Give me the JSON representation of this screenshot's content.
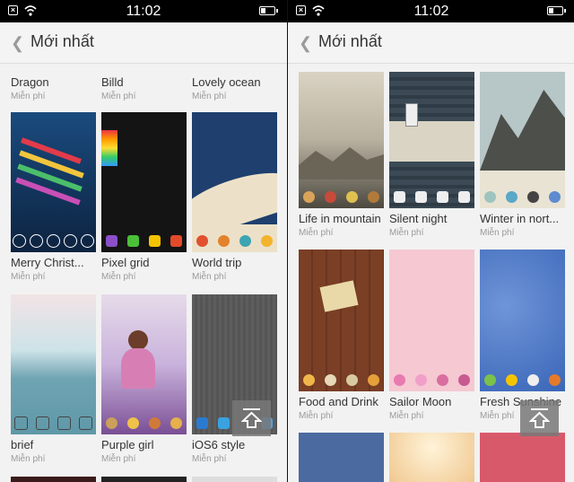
{
  "status_bar": {
    "time": "11:02"
  },
  "left_pane": {
    "title": "Mới nhất",
    "top_partial": [
      {
        "name": "Dragon",
        "price": "Miễn phí"
      },
      {
        "name": "Billd",
        "price": "Miễn phí"
      },
      {
        "name": "Lovely ocean",
        "price": "Miễn phí"
      }
    ],
    "rows": [
      {
        "name": "Merry Christ...",
        "price": "Miễn phí",
        "colors": [
          "#1a4b7e",
          "#0d2340"
        ]
      },
      {
        "name": "Pixel grid",
        "price": "Miễn phí",
        "colors": [
          "#111111",
          "#1e1e1e"
        ]
      },
      {
        "name": "World trip",
        "price": "Miễn phí",
        "colors": [
          "#1f3f6e",
          "#e9ddc4"
        ]
      },
      {
        "name": "brief",
        "price": "Miễn phí",
        "colors": [
          "#cde3e8",
          "#5f98a8"
        ]
      },
      {
        "name": "Purple girl",
        "price": "Miễn phí",
        "colors": [
          "#d7c6e3",
          "#7a4f95"
        ]
      },
      {
        "name": "iOS6 style",
        "price": "Miễn phí",
        "colors": [
          "#5d5d5d",
          "#2b2b2b"
        ]
      }
    ]
  },
  "right_pane": {
    "title": "Mới nhất",
    "rows": [
      {
        "name": "Life in mountain",
        "price": "Miễn phí",
        "colors": [
          "#c9c3b4",
          "#5a554a"
        ]
      },
      {
        "name": "Silent night",
        "price": "Miễn phí",
        "colors": [
          "#3b4a55",
          "#c6c3b5"
        ]
      },
      {
        "name": "Winter in nort...",
        "price": "Miễn phí",
        "colors": [
          "#b7c6c7",
          "#50534e"
        ]
      },
      {
        "name": "Food and Drink",
        "price": "Miễn phí",
        "colors": [
          "#7a3f25",
          "#5a2c16"
        ]
      },
      {
        "name": "Sailor Moon",
        "price": "Miễn phí",
        "colors": [
          "#f5c8d2",
          "#f0b3c2"
        ]
      },
      {
        "name": "Fresh Sunshine",
        "price": "Miễn phí",
        "colors": [
          "#4f7dc8",
          "#3a66b8"
        ]
      }
    ],
    "bottom_partial_colors": [
      "#4a6aa0",
      "#f0c890",
      "#d85a6a"
    ]
  },
  "colors": {
    "header_bg": "#f4f4f4",
    "text": "#333333",
    "sub": "#9a9a9a"
  }
}
